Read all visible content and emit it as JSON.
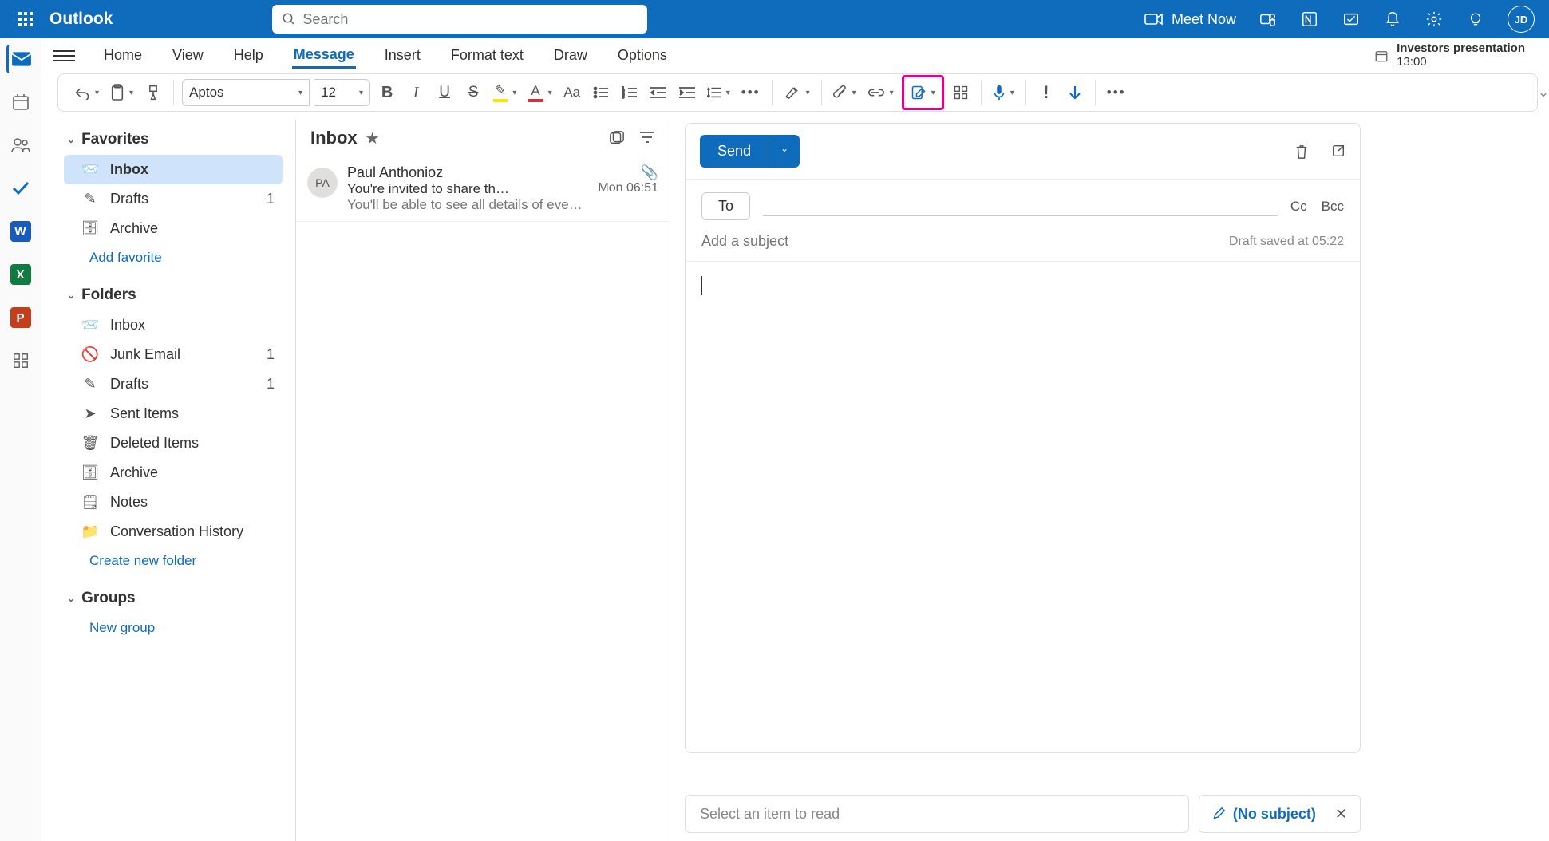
{
  "header": {
    "brand": "Outlook",
    "search_placeholder": "Search",
    "meet_now": "Meet Now",
    "avatar_initials": "JD"
  },
  "menubar": {
    "tabs": [
      "Home",
      "View",
      "Help",
      "Message",
      "Insert",
      "Format text",
      "Draw",
      "Options"
    ],
    "active_tab": "Message",
    "reminder_title": "Investors presentation",
    "reminder_time": "13:00"
  },
  "ribbon": {
    "font_name": "Aptos",
    "font_size": "12"
  },
  "sidebar": {
    "favorites_label": "Favorites",
    "folders_label": "Folders",
    "groups_label": "Groups",
    "add_favorite": "Add favorite",
    "create_folder": "Create new folder",
    "new_group": "New group",
    "favorites": [
      {
        "label": "Inbox",
        "count": "",
        "selected": true
      },
      {
        "label": "Drafts",
        "count": "1"
      },
      {
        "label": "Archive",
        "count": ""
      }
    ],
    "folders": [
      {
        "label": "Inbox",
        "count": ""
      },
      {
        "label": "Junk Email",
        "count": "1"
      },
      {
        "label": "Drafts",
        "count": "1"
      },
      {
        "label": "Sent Items",
        "count": ""
      },
      {
        "label": "Deleted Items",
        "count": ""
      },
      {
        "label": "Archive",
        "count": ""
      },
      {
        "label": "Notes",
        "count": ""
      },
      {
        "label": "Conversation History",
        "count": ""
      }
    ]
  },
  "msglist": {
    "title": "Inbox",
    "messages": [
      {
        "avatar": "PA",
        "from": "Paul Anthonioz",
        "subject": "You're invited to share th…",
        "time": "Mon 06:51",
        "preview": "You'll be able to see all details of eve…",
        "has_attachment": true
      }
    ]
  },
  "compose": {
    "send_label": "Send",
    "to_label": "To",
    "cc_label": "Cc",
    "bcc_label": "Bcc",
    "subject_placeholder": "Add a subject",
    "draft_saved": "Draft saved at 05:22"
  },
  "reading": {
    "empty_text": "Select an item to read",
    "draft_tab_label": "(No subject)"
  }
}
